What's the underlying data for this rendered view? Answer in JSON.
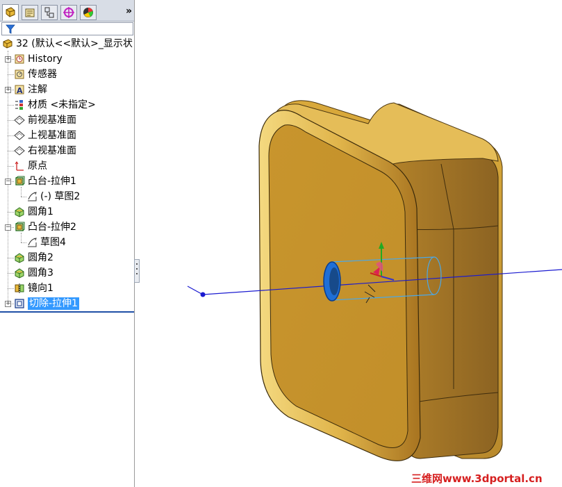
{
  "tabs": [
    {
      "name": "featuremanager-tab"
    },
    {
      "name": "propertymanager-tab"
    },
    {
      "name": "configurationmanager-tab"
    },
    {
      "name": "dimxpert-tab"
    },
    {
      "name": "display-manager-tab"
    }
  ],
  "more_label": "»",
  "tree": {
    "root": "32  (默认<<默认>_显示状",
    "items": [
      {
        "label": "History",
        "icon": "history-icon",
        "expandable": true
      },
      {
        "label": "传感器",
        "icon": "sensor-icon",
        "expandable": false
      },
      {
        "label": "注解",
        "icon": "annotation-icon",
        "expandable": true
      },
      {
        "label": "材质 <未指定>",
        "icon": "material-icon",
        "expandable": false
      },
      {
        "label": "前视基准面",
        "icon": "plane-icon",
        "expandable": false
      },
      {
        "label": "上视基准面",
        "icon": "plane-icon",
        "expandable": false
      },
      {
        "label": "右视基准面",
        "icon": "plane-icon",
        "expandable": false
      },
      {
        "label": "原点",
        "icon": "origin-icon",
        "expandable": false
      },
      {
        "label": "凸台-拉伸1",
        "icon": "boss-extrude-icon",
        "expandable": true
      },
      {
        "label": "(-) 草图2",
        "icon": "sketch-icon",
        "expandable": false
      },
      {
        "label": "圆角1",
        "icon": "fillet-icon",
        "expandable": false
      },
      {
        "label": "凸台-拉伸2",
        "icon": "boss-extrude-icon",
        "expandable": true
      },
      {
        "label": "草图4",
        "icon": "sketch-icon",
        "expandable": false
      },
      {
        "label": "圆角2",
        "icon": "fillet-icon",
        "expandable": false
      },
      {
        "label": "圆角3",
        "icon": "fillet-icon",
        "expandable": false
      },
      {
        "label": "镜向1",
        "icon": "mirror-icon",
        "expandable": false
      },
      {
        "label": "切除-拉伸1",
        "icon": "cut-extrude-icon",
        "expandable": true,
        "selected": true
      }
    ]
  },
  "watermark": "三维网www.3dportal.cn",
  "colors": {
    "part_face": "#c9962f",
    "part_side": "#b58427",
    "part_edge": "#e8c760",
    "selection": "#3399ff",
    "axis_line": "#1a1ad0",
    "watermark": "#d61f1f"
  }
}
